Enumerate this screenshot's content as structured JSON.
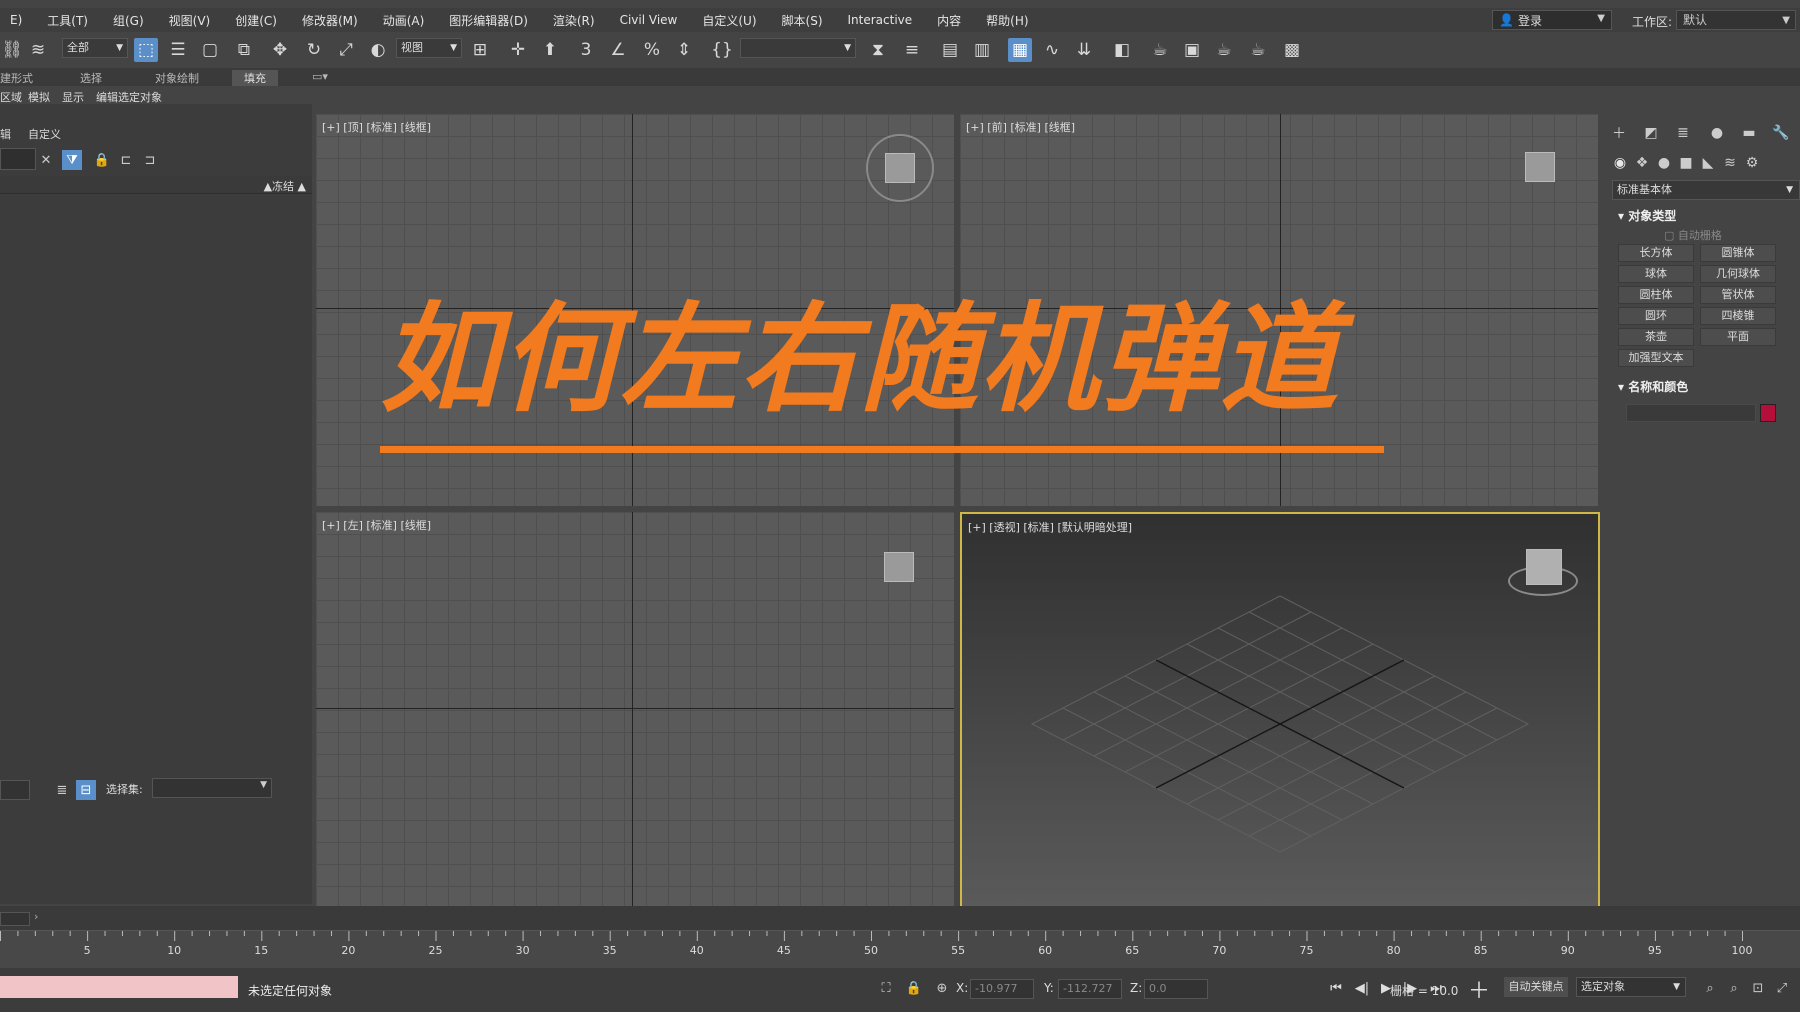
{
  "menu": [
    "E)",
    "工具(T)",
    "组(G)",
    "视图(V)",
    "创建(C)",
    "修改器(M)",
    "动画(A)",
    "图形编辑器(D)",
    "渲染(R)",
    "Civil View",
    "自定义(U)",
    "脚本(S)",
    "Interactive",
    "内容",
    "帮助(H)"
  ],
  "account": {
    "login": "登录",
    "workspace_label": "工作区:",
    "workspace_value": "默认"
  },
  "toolbar": {
    "filter_value": "全部",
    "refcoord_value": "视图"
  },
  "ribbon": {
    "tab1": "建形式",
    "tab2": "选择",
    "tab3": "对象绘制",
    "tab4": "填充"
  },
  "subtabs": {
    "t1": "区域",
    "t2": "模拟",
    "t3": "显示",
    "t4": "编辑选定对象"
  },
  "scene_explorer": {
    "tab1": "辑",
    "tab2": "自定义",
    "freeze_header": "▲冻结 ▲",
    "selection_set_label": "选择集:"
  },
  "viewports": {
    "top": "[+] [顶] [标准] [线框]",
    "front": "[+] [前] [标准] [线框]",
    "left": "[+] [左] [标准] [线框]",
    "persp": "[+] [透视] [标准] [默认明暗处理]"
  },
  "overlay": {
    "title": "如何左右随机弹道"
  },
  "command_panel": {
    "category": "标准基本体",
    "object_type_header": "对象类型",
    "autogrid": "自动栅格",
    "buttons": [
      "长方体",
      "圆锥体",
      "球体",
      "几何球体",
      "圆柱体",
      "管状体",
      "圆环",
      "四棱锥",
      "茶壶",
      "平面",
      "加强型文本"
    ],
    "name_color_header": "名称和颜色",
    "object_color": "#b40f3b"
  },
  "timeline": {
    "ticks": [
      "5",
      "10",
      "15",
      "20",
      "25",
      "30",
      "35",
      "40",
      "45",
      "50",
      "55",
      "60",
      "65",
      "70",
      "75",
      "80",
      "85",
      "90",
      "95",
      "100"
    ]
  },
  "status": {
    "message": "未选定任何对象",
    "x_label": "X:",
    "x_value": "-10.977",
    "y_label": "Y:",
    "y_value": "-112.727",
    "z_label": "Z:",
    "z_value": "0.0",
    "grid": "栅格 = 10.0",
    "auto_key": "自动关键点",
    "key_mode": "选定对象"
  },
  "accent_colors": {
    "overlay": "#f27a1f",
    "selection": "#5b8fc9",
    "active_viewport": "#d0b848"
  }
}
